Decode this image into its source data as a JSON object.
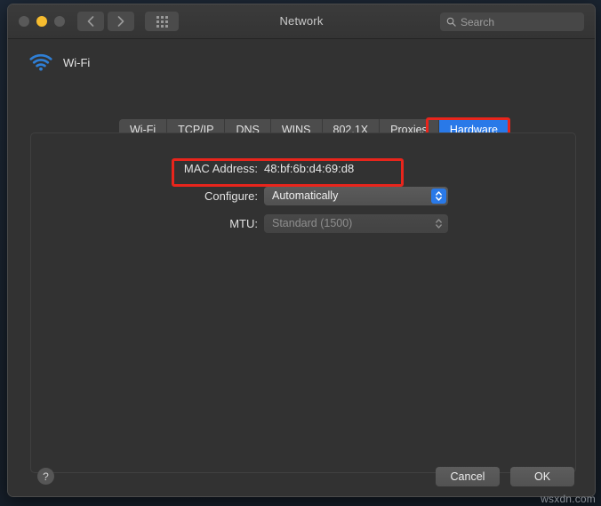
{
  "window": {
    "title": "Network",
    "traffic_lights": [
      "close",
      "minimize",
      "zoom"
    ],
    "search": {
      "placeholder": "Search",
      "value": "",
      "icon": "search-icon"
    },
    "nav": {
      "back": "‹",
      "forward": "›",
      "show_all": "grid-icon"
    }
  },
  "interface": {
    "name": "Wi-Fi",
    "icon": "wifi-icon",
    "icon_color": "#2f7fd6"
  },
  "tabs": [
    {
      "label": "Wi-Fi",
      "selected": false
    },
    {
      "label": "TCP/IP",
      "selected": false
    },
    {
      "label": "DNS",
      "selected": false
    },
    {
      "label": "WINS",
      "selected": false
    },
    {
      "label": "802.1X",
      "selected": false
    },
    {
      "label": "Proxies",
      "selected": false
    },
    {
      "label": "Hardware",
      "selected": true
    }
  ],
  "form": {
    "mac": {
      "label": "MAC Address:",
      "value": "48:bf:6b:d4:69:d8"
    },
    "configure": {
      "label": "Configure:",
      "value": "Automatically",
      "enabled": true
    },
    "mtu": {
      "label": "MTU:",
      "value": "Standard (1500)",
      "enabled": false
    }
  },
  "annotations": {
    "color": "#e8251c",
    "targets": [
      "hardware-tab",
      "mac-address-row"
    ]
  },
  "footer": {
    "help": "?",
    "cancel": "Cancel",
    "ok": "OK"
  },
  "watermark": "wsxdn.com"
}
